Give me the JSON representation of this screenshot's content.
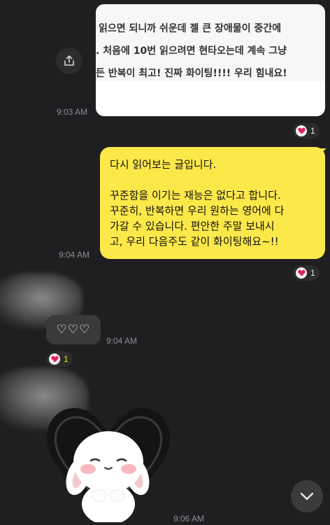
{
  "image_message": {
    "lines": [
      "읽으면 되니까 쉬운데 젤 큰 장애물이 중간에 ",
      ". 처음에 10번 읽으려면 현타오는데 계속 그냥",
      "든 반복이 최고! 진짜 화이팅!!!! 우리 힘내요!"
    ],
    "time": "9:03 AM",
    "reaction_count": "1"
  },
  "my_message": {
    "text": "다시 읽어보는 글입니다.\n\n꾸준함을 이기는 재능은 없다고 합니다.\n꾸준히, 반복하면 우리 원하는 영어에 다\n가갈 수 있습니다. 편안한 주말 보내시\n고, 우리 다음주도 같이 화이팅해요~!!",
    "time": "9:04 AM",
    "reaction_count": "1"
  },
  "reply_message": {
    "text": "♡♡♡",
    "time": "9:04 AM",
    "reaction_count": "1"
  },
  "sticker_message": {
    "time": "9:06 AM"
  },
  "icons": {
    "share": "share-icon",
    "heart": "heart-icon",
    "scroll": "chevron-down-icon"
  },
  "colors": {
    "background": "#1f1f21",
    "my_bubble": "#fde84a",
    "heart": "#e0245e",
    "highlight_count": "#f7e600"
  }
}
